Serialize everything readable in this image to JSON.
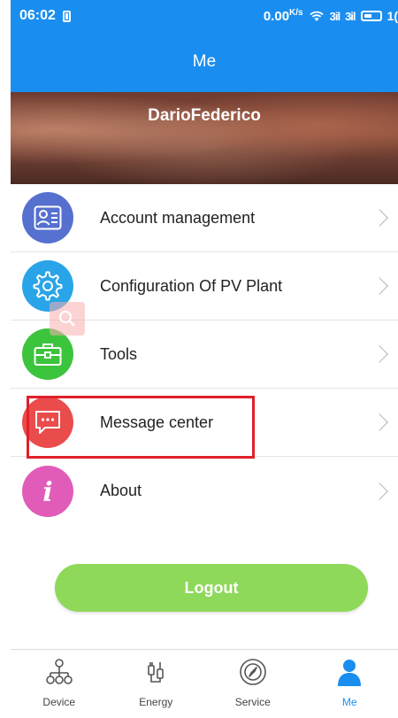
{
  "status_bar": {
    "time": "06:02",
    "net_speed": "0.00",
    "net_unit": "K/s",
    "signal_1": "3il",
    "signal_2": "3il",
    "battery": "1("
  },
  "header": {
    "title": "Me"
  },
  "profile": {
    "username": "DarioFederico"
  },
  "menu": {
    "items": [
      {
        "label": "Account management",
        "icon": "account-card-icon",
        "color": "#5670cf"
      },
      {
        "label": "Configuration Of PV Plant",
        "icon": "gear-icon",
        "color": "#29a4e8"
      },
      {
        "label": "Tools",
        "icon": "toolbox-icon",
        "color": "#3cc43c"
      },
      {
        "label": "Message center",
        "icon": "chat-icon",
        "color": "#ea4c4c"
      },
      {
        "label": "About",
        "icon": "info-icon",
        "color": "#e15cb8"
      }
    ]
  },
  "logout": {
    "label": "Logout",
    "color": "#8ed85a"
  },
  "bottom_nav": {
    "items": [
      {
        "label": "Device",
        "icon": "device-network-icon"
      },
      {
        "label": "Energy",
        "icon": "energy-plug-icon"
      },
      {
        "label": "Service",
        "icon": "service-compass-icon"
      },
      {
        "label": "Me",
        "icon": "person-icon",
        "active": true
      }
    ]
  },
  "colors": {
    "accent": "#1a8ef0",
    "highlight": "#e0202a"
  }
}
